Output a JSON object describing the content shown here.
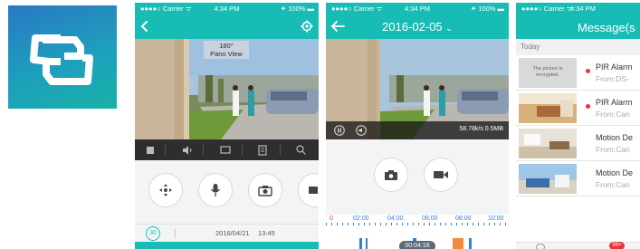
{
  "logo": {
    "name": "app-logo"
  },
  "screen1": {
    "status": {
      "carrier": "●●●●○ Carrier ᯤ",
      "time": "4:34 PM",
      "battery": "✦ 100% ▬"
    },
    "overlay": {
      "line1": "180°",
      "line2": "Pano View"
    },
    "date": "2016/04/21",
    "time": "13:45",
    "sync_badge": "30"
  },
  "screen2": {
    "status": {
      "carrier": "●●●●○ Carrier ᯤ",
      "time": "4:34 PM",
      "battery": "✦ 100% ▬"
    },
    "title": "2016-02-05",
    "chevron": "⌄",
    "bitrate": "58.78k/s 0.5MB",
    "timeline": {
      "ticks": [
        "0",
        "02:00",
        "04:00",
        "06:00",
        "08:00",
        "10:00"
      ],
      "cursor": "00:04:16"
    }
  },
  "screen3": {
    "status": {
      "carrier": "●●●●○ Carrier ᯤ",
      "time": "4:34 PM"
    },
    "title": "Message(s",
    "section": "Today",
    "items": [
      {
        "title": "PIR Alarm",
        "from": "From:DS-",
        "thumb_text": "The picture is encrypted.",
        "unread": true
      },
      {
        "title": "PIR Alarm",
        "from": "From:Can",
        "thumb_text": "",
        "unread": true
      },
      {
        "title": "Motion De",
        "from": "From:Can",
        "thumb_text": "",
        "unread": false
      },
      {
        "title": "Motion De",
        "from": "From:Can",
        "thumb_text": "",
        "unread": false
      }
    ],
    "badge": "99+"
  },
  "colors": {
    "teal": "#17bdb5",
    "dark_bar": "#2e2e2e",
    "alert_red": "#e8333f",
    "timeline_blue": "#2f7fe0",
    "timeline_orange": "#f08a3c"
  }
}
